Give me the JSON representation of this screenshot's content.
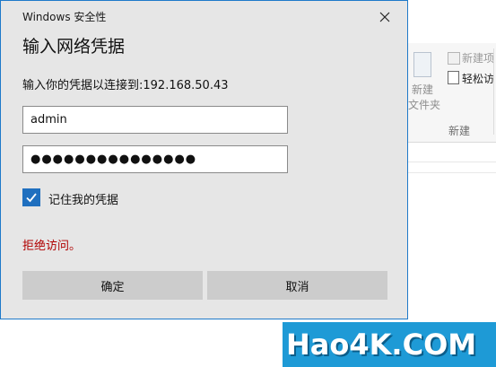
{
  "dialog": {
    "title": "Windows 安全性",
    "heading": "输入网络凭据",
    "prompt": "输入你的凭据以连接到:192.168.50.43",
    "username_value": "admin",
    "password_mask": "●●●●●●●●●●●●●●●",
    "remember_label": "记住我的凭据",
    "remember_checked": true,
    "error_message": "拒绝访问。",
    "ok_label": "确定",
    "cancel_label": "取消"
  },
  "explorer": {
    "big_button_label_line1": "新建",
    "big_button_label_line2": "文件夹",
    "new_item_label": "新建项",
    "easy_access_label": "轻松访",
    "group_label": "新建"
  },
  "watermark": {
    "text": "Hao4K.COM"
  },
  "colors": {
    "accent": "#1f6fbf",
    "error": "#b00000",
    "watermark_bg": "#1e9ad6"
  }
}
